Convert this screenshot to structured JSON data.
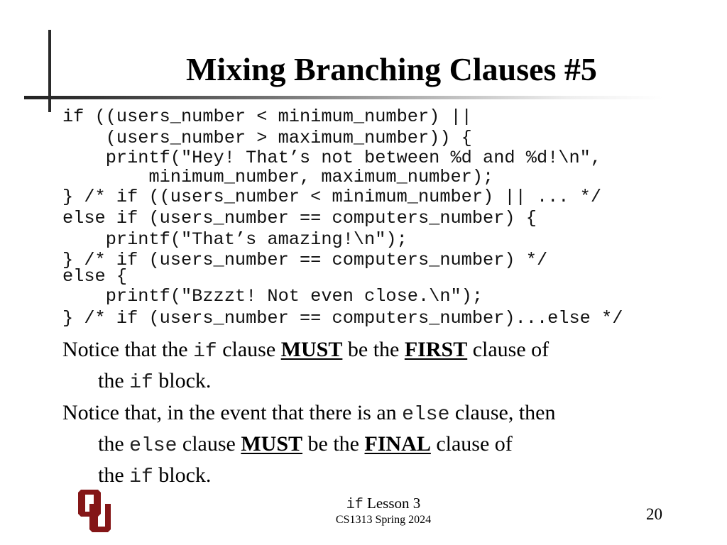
{
  "slide": {
    "title": "Mixing Branching Clauses #5",
    "code_lines": [
      "if ((users_number < minimum_number) ||",
      "    (users_number > maximum_number)) {",
      "    printf(\"Hey! That’s not between %d and %d!\\n\",",
      "        minimum_number, maximum_number);",
      "} /* if ((users_number < minimum_number) || ... */",
      "else if (users_number == computers_number) {",
      "    printf(\"That’s amazing!\\n\");",
      "} /* if (users_number == computers_number) */",
      "else {",
      "    printf(\"Bzzzt! Not even close.\\n\");",
      "} /* if (users_number == computers_number)...else */"
    ],
    "bullets": [
      {
        "line1": {
          "t1": "Notice that the ",
          "code1": "if",
          "t2": " clause ",
          "emph1": "MUST",
          "t3": " be the ",
          "emph2": "FIRST",
          "t4": " clause of"
        },
        "line2": {
          "t1": "the ",
          "code1": "if",
          "t2": " block."
        }
      },
      {
        "line1": {
          "t1": "Notice that, in the event that there is an ",
          "code1": "else",
          "t2": " clause, then"
        },
        "line2": {
          "t1": "the ",
          "code1": "else",
          "t2": " clause ",
          "emph1": "MUST",
          "t3": " be the ",
          "emph2": "FINAL",
          "t4": " clause of"
        },
        "line3": {
          "t1": "the ",
          "code1": "if",
          "t2": " block."
        }
      }
    ]
  },
  "footer": {
    "logo_icon": "ou-logo",
    "logo_color": "#841617",
    "lesson_code": "if",
    "lesson_text": " Lesson 3",
    "course": "CS1313 Spring 2024",
    "page_number": "20"
  }
}
